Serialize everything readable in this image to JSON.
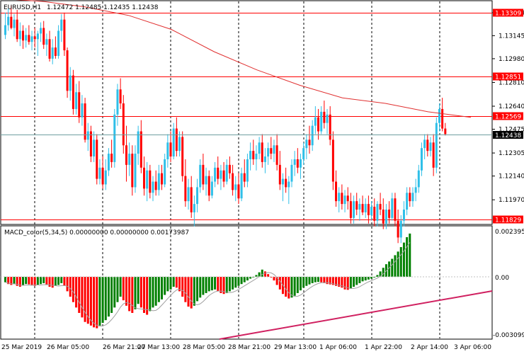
{
  "header": {
    "symbol": "EURUSD,H1",
    "ohlc": "1.12472 1.12485 1.12435 1.12438"
  },
  "macd_header": {
    "title": "MACD_color(5,34,5) 0.00000000 0.00000000 0.00173987"
  },
  "colors": {
    "bull": "#2fbfe8",
    "bear": "#ff0000",
    "hist_pos": "#008000",
    "hist_neg": "#ff0000",
    "ma": "#e03030",
    "bid_line": "#6f9fa0",
    "trend": "#d02060",
    "signal": "#a0a0a0"
  },
  "price_axis": {
    "ticks": [
      "1.13309",
      "1.13145",
      "1.12980",
      "1.12810",
      "1.12640",
      "1.12475",
      "1.12305",
      "1.12140",
      "1.11970",
      "1.11805"
    ],
    "hidden_ticks": [
      "1.11805"
    ]
  },
  "levels": [
    {
      "value": "1.13309",
      "color": "#ff0000"
    },
    {
      "value": "1.12851",
      "color": "#ff0000"
    },
    {
      "value": "1.12569",
      "color": "#ff0000"
    },
    {
      "value": "1.11829",
      "color": "#ff0000"
    }
  ],
  "bid": {
    "value": "1.12438"
  },
  "macd_axis": {
    "max": "0.0023952",
    "zero": "0.00",
    "min": "-0.003099"
  },
  "time_axis": [
    "25 Mar 2019",
    "26 Mar 05:00",
    "26 Mar 21:00",
    "27 Mar 13:00",
    "28 Mar 05:00",
    "28 Mar 21:00",
    "29 Mar 13:00",
    "1 Apr 06:00",
    "1 Apr 22:00",
    "2 Apr 14:00",
    "3 Apr 06:00"
  ],
  "chart_data": {
    "type": "candlestick",
    "price_range": [
      1.11805,
      1.134
    ],
    "macd_range": [
      -0.003099,
      0.0023952
    ],
    "candles": [
      [
        1.1315,
        1.1331,
        1.1312,
        1.1322
      ],
      [
        1.1322,
        1.1334,
        1.1318,
        1.1328
      ],
      [
        1.1328,
        1.1336,
        1.1319,
        1.132
      ],
      [
        1.132,
        1.133,
        1.1314,
        1.1326
      ],
      [
        1.1326,
        1.1333,
        1.131,
        1.1312
      ],
      [
        1.1312,
        1.1324,
        1.1307,
        1.1318
      ],
      [
        1.1318,
        1.1322,
        1.1305,
        1.1311
      ],
      [
        1.1311,
        1.132,
        1.1306,
        1.1315
      ],
      [
        1.1315,
        1.1322,
        1.1308,
        1.131
      ],
      [
        1.131,
        1.1318,
        1.1304,
        1.1314
      ],
      [
        1.1314,
        1.132,
        1.1306,
        1.1312
      ],
      [
        1.1312,
        1.1318,
        1.13,
        1.1316
      ],
      [
        1.1316,
        1.1324,
        1.131,
        1.132
      ],
      [
        1.132,
        1.1325,
        1.1305,
        1.1308
      ],
      [
        1.1308,
        1.1316,
        1.13,
        1.1312
      ],
      [
        1.1312,
        1.1318,
        1.1296,
        1.1298
      ],
      [
        1.1298,
        1.1312,
        1.1294,
        1.1306
      ],
      [
        1.1306,
        1.1314,
        1.1298,
        1.13
      ],
      [
        1.13,
        1.1322,
        1.1298,
        1.1318
      ],
      [
        1.1318,
        1.133,
        1.131,
        1.1326
      ],
      [
        1.1326,
        1.1331,
        1.13,
        1.1304
      ],
      [
        1.1304,
        1.1306,
        1.127,
        1.1275
      ],
      [
        1.1275,
        1.1292,
        1.1268,
        1.1286
      ],
      [
        1.1286,
        1.129,
        1.1258,
        1.1262
      ],
      [
        1.1262,
        1.128,
        1.1258,
        1.1274
      ],
      [
        1.1274,
        1.1282,
        1.1252,
        1.1256
      ],
      [
        1.1256,
        1.1272,
        1.125,
        1.1266
      ],
      [
        1.1266,
        1.127,
        1.1238,
        1.124
      ],
      [
        1.124,
        1.1252,
        1.1232,
        1.1246
      ],
      [
        1.1246,
        1.125,
        1.1224,
        1.1228
      ],
      [
        1.1228,
        1.1246,
        1.1224,
        1.124
      ],
      [
        1.124,
        1.1244,
        1.1208,
        1.1212
      ],
      [
        1.1212,
        1.1226,
        1.1208,
        1.122
      ],
      [
        1.122,
        1.1228,
        1.1205,
        1.1208
      ],
      [
        1.1208,
        1.1226,
        1.1204,
        1.1218
      ],
      [
        1.1218,
        1.1234,
        1.1214,
        1.123
      ],
      [
        1.123,
        1.124,
        1.122,
        1.1224
      ],
      [
        1.1224,
        1.1262,
        1.122,
        1.1258
      ],
      [
        1.1258,
        1.128,
        1.125,
        1.1276
      ],
      [
        1.1276,
        1.1284,
        1.1262,
        1.1266
      ],
      [
        1.1266,
        1.1272,
        1.123,
        1.1236
      ],
      [
        1.1236,
        1.125,
        1.121,
        1.1222
      ],
      [
        1.1222,
        1.1238,
        1.1214,
        1.123
      ],
      [
        1.123,
        1.1236,
        1.12,
        1.1206
      ],
      [
        1.1206,
        1.1236,
        1.1202,
        1.123
      ],
      [
        1.123,
        1.125,
        1.1222,
        1.1246
      ],
      [
        1.1246,
        1.1254,
        1.1216,
        1.122
      ],
      [
        1.122,
        1.1228,
        1.12,
        1.1205
      ],
      [
        1.1205,
        1.1224,
        1.1196,
        1.1218
      ],
      [
        1.1218,
        1.1222,
        1.1198,
        1.1202
      ],
      [
        1.1202,
        1.1214,
        1.1196,
        1.121
      ],
      [
        1.121,
        1.1218,
        1.12,
        1.1204
      ],
      [
        1.1204,
        1.1222,
        1.12,
        1.1216
      ],
      [
        1.1216,
        1.1222,
        1.1204,
        1.1208
      ],
      [
        1.1208,
        1.123,
        1.1206,
        1.1226
      ],
      [
        1.1226,
        1.1244,
        1.122,
        1.1238
      ],
      [
        1.1238,
        1.1246,
        1.1224,
        1.1228
      ],
      [
        1.1228,
        1.1252,
        1.1226,
        1.1248
      ],
      [
        1.1248,
        1.1256,
        1.1228,
        1.1232
      ],
      [
        1.1232,
        1.1246,
        1.1228,
        1.1242
      ],
      [
        1.1242,
        1.1246,
        1.121,
        1.1214
      ],
      [
        1.1214,
        1.1226,
        1.1192,
        1.1196
      ],
      [
        1.1196,
        1.1212,
        1.119,
        1.1206
      ],
      [
        1.1206,
        1.1214,
        1.1184,
        1.1188
      ],
      [
        1.1188,
        1.12,
        1.1178,
        1.1194
      ],
      [
        1.1194,
        1.1212,
        1.1188,
        1.1206
      ],
      [
        1.1206,
        1.1226,
        1.1202,
        1.1222
      ],
      [
        1.1222,
        1.123,
        1.1204,
        1.1208
      ],
      [
        1.1208,
        1.122,
        1.12,
        1.1214
      ],
      [
        1.1214,
        1.1218,
        1.1196,
        1.12
      ],
      [
        1.12,
        1.1214,
        1.1198,
        1.121
      ],
      [
        1.121,
        1.1224,
        1.1206,
        1.122
      ],
      [
        1.122,
        1.1228,
        1.1208,
        1.1212
      ],
      [
        1.1212,
        1.1222,
        1.1204,
        1.1218
      ],
      [
        1.1218,
        1.1224,
        1.1206,
        1.121
      ],
      [
        1.121,
        1.1226,
        1.1208,
        1.1222
      ],
      [
        1.1222,
        1.1228,
        1.1212,
        1.1216
      ],
      [
        1.1216,
        1.1222,
        1.12,
        1.1204
      ],
      [
        1.1204,
        1.1214,
        1.1196,
        1.1208
      ],
      [
        1.1208,
        1.1216,
        1.1194,
        1.1198
      ],
      [
        1.1198,
        1.122,
        1.1196,
        1.1216
      ],
      [
        1.1216,
        1.1226,
        1.1206,
        1.121
      ],
      [
        1.121,
        1.123,
        1.1206,
        1.1226
      ],
      [
        1.1226,
        1.1238,
        1.1218,
        1.1232
      ],
      [
        1.1232,
        1.124,
        1.1222,
        1.1226
      ],
      [
        1.1226,
        1.1236,
        1.1218,
        1.123
      ],
      [
        1.123,
        1.1242,
        1.1226,
        1.1238
      ],
      [
        1.1238,
        1.1244,
        1.122,
        1.1224
      ],
      [
        1.1224,
        1.1234,
        1.1216,
        1.1228
      ],
      [
        1.1228,
        1.1238,
        1.1222,
        1.1234
      ],
      [
        1.1234,
        1.1242,
        1.1226,
        1.123
      ],
      [
        1.123,
        1.124,
        1.1224,
        1.1236
      ],
      [
        1.1236,
        1.1244,
        1.1218,
        1.1222
      ],
      [
        1.1222,
        1.1232,
        1.1204,
        1.1208
      ],
      [
        1.1208,
        1.1216,
        1.1196,
        1.1212
      ],
      [
        1.1212,
        1.122,
        1.1202,
        1.1206
      ],
      [
        1.1206,
        1.1214,
        1.1194,
        1.121
      ],
      [
        1.121,
        1.1226,
        1.1206,
        1.1222
      ],
      [
        1.1222,
        1.1232,
        1.1214,
        1.1226
      ],
      [
        1.1226,
        1.1234,
        1.1216,
        1.122
      ],
      [
        1.122,
        1.123,
        1.1212,
        1.1226
      ],
      [
        1.1226,
        1.1238,
        1.1222,
        1.1234
      ],
      [
        1.1234,
        1.1244,
        1.1226,
        1.124
      ],
      [
        1.124,
        1.125,
        1.123,
        1.1236
      ],
      [
        1.1236,
        1.1254,
        1.1232,
        1.125
      ],
      [
        1.125,
        1.1264,
        1.1244,
        1.1256
      ],
      [
        1.1256,
        1.1262,
        1.124,
        1.1246
      ],
      [
        1.1246,
        1.1264,
        1.1244,
        1.126
      ],
      [
        1.126,
        1.1268,
        1.1248,
        1.1252
      ],
      [
        1.1252,
        1.1262,
        1.1244,
        1.1258
      ],
      [
        1.1258,
        1.1264,
        1.1236,
        1.124
      ],
      [
        1.124,
        1.1246,
        1.1204,
        1.121
      ],
      [
        1.121,
        1.1218,
        1.1192,
        1.1196
      ],
      [
        1.1196,
        1.1206,
        1.1188,
        1.1202
      ],
      [
        1.1202,
        1.1208,
        1.119,
        1.1194
      ],
      [
        1.1194,
        1.1204,
        1.1188,
        1.12
      ],
      [
        1.12,
        1.1206,
        1.119,
        1.1196
      ],
      [
        1.1196,
        1.1202,
        1.118,
        1.1184
      ],
      [
        1.1184,
        1.12,
        1.118,
        1.1196
      ],
      [
        1.1196,
        1.1202,
        1.1186,
        1.119
      ],
      [
        1.119,
        1.1198,
        1.1182,
        1.1194
      ],
      [
        1.1194,
        1.12,
        1.1186,
        1.1188
      ],
      [
        1.1188,
        1.1198,
        1.1184,
        1.1194
      ],
      [
        1.1194,
        1.12,
        1.118,
        1.1186
      ],
      [
        1.1186,
        1.1196,
        1.1182,
        1.1192
      ],
      [
        1.1192,
        1.1198,
        1.1178,
        1.1182
      ],
      [
        1.1182,
        1.1196,
        1.1178,
        1.1194
      ],
      [
        1.1194,
        1.1202,
        1.1186,
        1.119
      ],
      [
        1.119,
        1.1198,
        1.1176,
        1.118
      ],
      [
        1.118,
        1.1194,
        1.1176,
        1.119
      ],
      [
        1.119,
        1.1196,
        1.118,
        1.1184
      ],
      [
        1.1184,
        1.1202,
        1.1182,
        1.1198
      ],
      [
        1.1198,
        1.1202,
        1.1178,
        1.1182
      ],
      [
        1.1182,
        1.119,
        1.1166,
        1.117
      ],
      [
        1.117,
        1.1186,
        1.1166,
        1.1182
      ],
      [
        1.1182,
        1.1196,
        1.1178,
        1.119
      ],
      [
        1.119,
        1.1206,
        1.1186,
        1.1202
      ],
      [
        1.1202,
        1.1206,
        1.1192,
        1.1196
      ],
      [
        1.1196,
        1.1206,
        1.1192,
        1.1202
      ],
      [
        1.1202,
        1.1212,
        1.1196,
        1.1206
      ],
      [
        1.1206,
        1.1222,
        1.1202,
        1.1218
      ],
      [
        1.1218,
        1.1238,
        1.1214,
        1.1234
      ],
      [
        1.1234,
        1.1244,
        1.1226,
        1.124
      ],
      [
        1.124,
        1.1244,
        1.1228,
        1.1232
      ],
      [
        1.1232,
        1.1242,
        1.1228,
        1.1238
      ],
      [
        1.1238,
        1.1244,
        1.1214,
        1.122
      ],
      [
        1.122,
        1.1256,
        1.1216,
        1.1252
      ],
      [
        1.1252,
        1.1266,
        1.1246,
        1.1262
      ],
      [
        1.1262,
        1.127,
        1.1246,
        1.1248
      ],
      [
        1.1248,
        1.1252,
        1.1243,
        1.1244
      ]
    ],
    "ma": [
      1.1341,
      1.1339,
      1.1335,
      1.1329,
      1.1319,
      1.1303,
      1.129,
      1.1279,
      1.127,
      1.1266,
      1.126,
      1.1256
    ],
    "macd_hist": [
      -0.0003,
      -0.0004,
      -0.00045,
      -0.0004,
      -0.0005,
      -0.00055,
      -0.00045,
      -0.0004,
      -0.00042,
      -0.00048,
      -0.0005,
      -0.00045,
      -0.0004,
      -0.00035,
      -0.00045,
      -0.00055,
      -0.0006,
      -0.0005,
      -0.00045,
      -0.00035,
      -0.0005,
      -0.0008,
      -0.0011,
      -0.0014,
      -0.0017,
      -0.002,
      -0.00225,
      -0.0025,
      -0.0026,
      -0.0027,
      -0.0028,
      -0.00285,
      -0.0027,
      -0.00255,
      -0.0024,
      -0.0022,
      -0.002,
      -0.0017,
      -0.0014,
      -0.0011,
      -0.0013,
      -0.0016,
      -0.0019,
      -0.002,
      -0.0018,
      -0.0015,
      -0.0017,
      -0.002,
      -0.0021,
      -0.0019,
      -0.0017,
      -0.0016,
      -0.0014,
      -0.00125,
      -0.001,
      -0.0008,
      -0.0007,
      -0.00055,
      -0.0006,
      -0.0008,
      -0.0011,
      -0.0014,
      -0.00165,
      -0.00175,
      -0.0016,
      -0.00135,
      -0.00115,
      -0.001,
      -0.0009,
      -0.0008,
      -0.00075,
      -0.0007,
      -0.0008,
      -0.0009,
      -0.00095,
      -0.0009,
      -0.0008,
      -0.0007,
      -0.0006,
      -0.0005,
      -0.0004,
      -0.0003,
      -0.0002,
      -0.0001,
      0.0,
      0.0001,
      0.00025,
      0.0004,
      0.0003,
      0.00015,
      0.0,
      -0.0002,
      -0.00045,
      -0.0007,
      -0.00095,
      -0.0011,
      -0.0012,
      -0.00115,
      -0.00105,
      -0.0009,
      -0.00075,
      -0.0006,
      -0.0005,
      -0.00042,
      -0.00035,
      -0.0003,
      -0.00028,
      -0.0003,
      -0.00035,
      -0.0004,
      -0.00042,
      -0.00045,
      -0.0005,
      -0.00055,
      -0.0006,
      -0.0007,
      -0.00072,
      -0.00065,
      -0.00055,
      -0.00045,
      -0.00035,
      -0.00025,
      -0.0002,
      -0.00015,
      -0.0001,
      0.0,
      0.0001,
      0.0003,
      0.0005,
      0.0007,
      0.00085,
      0.001,
      0.0012,
      0.0014,
      0.00165,
      0.0019,
      0.0022,
      0.0024
    ]
  }
}
